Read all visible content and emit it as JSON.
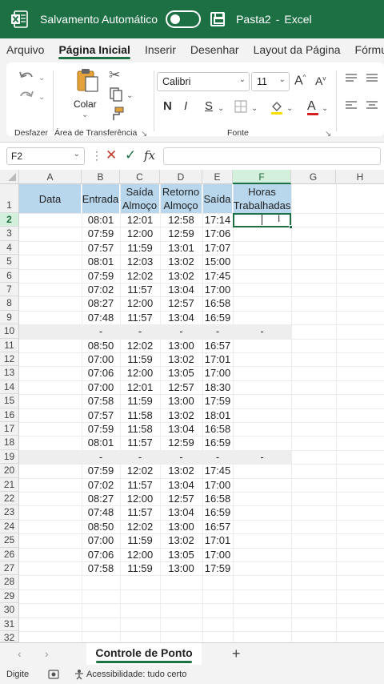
{
  "titlebar": {
    "autosave_label": "Salvamento Automático",
    "filename": "Pasta2",
    "app": "Excel",
    "separator": "-",
    "autosave_on": false
  },
  "tabs": [
    "Arquivo",
    "Página Inicial",
    "Inserir",
    "Desenhar",
    "Layout da Página",
    "Fórmulas"
  ],
  "active_tab": "Página Inicial",
  "ribbon": {
    "groups": {
      "undo": "Desfazer",
      "clipboard": "Área de Transferência",
      "font": "Fonte"
    },
    "paste_label": "Colar",
    "font_name": "Calibri",
    "font_size": "11",
    "bold": "N",
    "italic": "I",
    "underline": "S"
  },
  "formula_bar": {
    "name_box": "F2",
    "formula": ""
  },
  "columns": [
    "A",
    "B",
    "C",
    "D",
    "E",
    "F",
    "G",
    "H"
  ],
  "selected_column": "F",
  "selected_row": 2,
  "headers": {
    "A": "Data",
    "B": "Entrada",
    "C1": "Saída",
    "C2": "Almoço",
    "D1": "Retorno",
    "D2": "Almoço",
    "E": "Saída",
    "F1": "Horas",
    "F2": "Trabalhadas"
  },
  "rows": [
    [
      "08:01",
      "12:01",
      "12:58",
      "17:14",
      ""
    ],
    [
      "07:59",
      "12:00",
      "12:59",
      "17:06",
      ""
    ],
    [
      "07:57",
      "11:59",
      "13:01",
      "17:07",
      ""
    ],
    [
      "08:01",
      "12:03",
      "13:02",
      "15:00",
      ""
    ],
    [
      "07:59",
      "12:02",
      "13:02",
      "17:45",
      ""
    ],
    [
      "07:02",
      "11:57",
      "13:04",
      "17:00",
      ""
    ],
    [
      "08:27",
      "12:00",
      "12:57",
      "16:58",
      ""
    ],
    [
      "07:48",
      "11:57",
      "13:04",
      "16:59",
      ""
    ],
    [
      "-",
      "-",
      "-",
      "-",
      "-"
    ],
    [
      "08:50",
      "12:02",
      "13:00",
      "16:57",
      ""
    ],
    [
      "07:00",
      "11:59",
      "13:02",
      "17:01",
      ""
    ],
    [
      "07:06",
      "12:00",
      "13:05",
      "17:00",
      ""
    ],
    [
      "07:00",
      "12:01",
      "12:57",
      "18:30",
      ""
    ],
    [
      "07:58",
      "11:59",
      "13:00",
      "17:59",
      ""
    ],
    [
      "07:57",
      "11:58",
      "13:02",
      "18:01",
      ""
    ],
    [
      "07:59",
      "11:58",
      "13:04",
      "16:58",
      ""
    ],
    [
      "08:01",
      "11:57",
      "12:59",
      "16:59",
      ""
    ],
    [
      "-",
      "-",
      "-",
      "-",
      "-"
    ],
    [
      "07:59",
      "12:02",
      "13:02",
      "17:45",
      ""
    ],
    [
      "07:02",
      "11:57",
      "13:04",
      "17:00",
      ""
    ],
    [
      "08:27",
      "12:00",
      "12:57",
      "16:58",
      ""
    ],
    [
      "07:48",
      "11:57",
      "13:04",
      "16:59",
      ""
    ],
    [
      "08:50",
      "12:02",
      "13:00",
      "16:57",
      ""
    ],
    [
      "07:00",
      "11:59",
      "13:02",
      "17:01",
      ""
    ],
    [
      "07:06",
      "12:00",
      "13:05",
      "17:00",
      ""
    ],
    [
      "07:58",
      "11:59",
      "13:00",
      "17:59",
      ""
    ]
  ],
  "row_numbers": [
    1,
    2,
    3,
    4,
    5,
    6,
    7,
    8,
    9,
    10,
    11,
    12,
    13,
    14,
    15,
    16,
    17,
    18,
    19,
    20,
    21,
    22,
    23,
    24,
    25,
    26,
    27,
    28,
    29,
    30,
    31,
    32
  ],
  "sheet_tab": "Controle de Ponto",
  "add_sheet": "+",
  "status": {
    "mode": "Digite",
    "accessibility": "Acessibilidade: tudo certo"
  },
  "colors": {
    "excel_green": "#1d7044",
    "header_fill": "#b8d6ec",
    "separator_fill": "#eeeeee",
    "selection_fill": "#d3f0dd"
  }
}
